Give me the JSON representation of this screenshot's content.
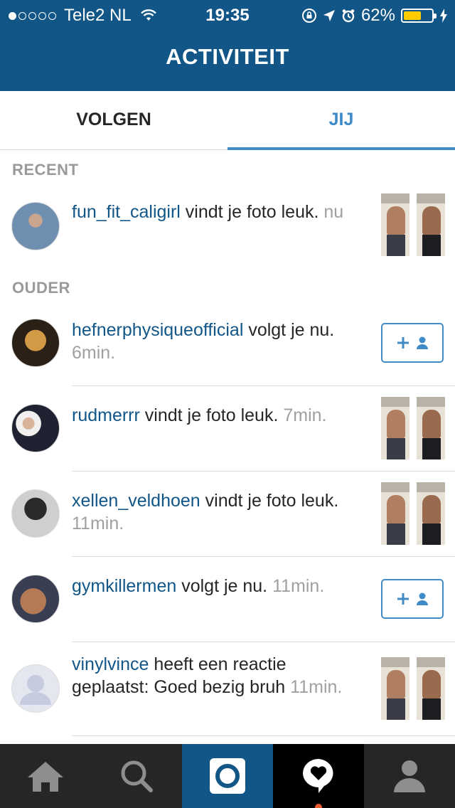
{
  "status_bar": {
    "carrier": "Tele2 NL",
    "time": "19:35",
    "battery": "62%",
    "battery_level": 0.62,
    "signal_bars_filled": 1,
    "signal_bars_total": 5
  },
  "header": {
    "title": "ACTIVITEIT"
  },
  "tabs": [
    {
      "label": "VOLGEN",
      "active": false
    },
    {
      "label": "JIJ",
      "active": true
    }
  ],
  "sections": {
    "recent": "RECENT",
    "older": "OUDER"
  },
  "activities": [
    {
      "username": "fun_fit_caligirl",
      "action": " vindt je foto leuk.",
      "time": "nu",
      "type": "photo"
    },
    {
      "username": "hefnerphysiqueofficial",
      "action": " volgt je nu.",
      "time": "6min.",
      "type": "follow"
    },
    {
      "username": "rudmerrr",
      "action": " vindt je foto leuk.",
      "time": "7min.",
      "type": "photo"
    },
    {
      "username": "xellen_veldhoen",
      "action": " vindt je foto leuk.",
      "time": "11min.",
      "type": "photo"
    },
    {
      "username": "gymkillermen",
      "action": " volgt je nu.",
      "time": "11min.",
      "type": "follow"
    },
    {
      "username": "vinylvince",
      "action": " heeft een reactie geplaatst: Goed bezig bruh",
      "time": "11min.",
      "type": "photo"
    }
  ],
  "colors": {
    "header": "#125688",
    "accent": "#3f8bc7",
    "username": "#125688",
    "tabbar": "#262626",
    "notification": "#e8582a"
  },
  "tabbar": {
    "items": [
      "home-icon",
      "search-icon",
      "camera-icon",
      "activity-icon",
      "profile-icon"
    ],
    "active": "activity-icon"
  }
}
